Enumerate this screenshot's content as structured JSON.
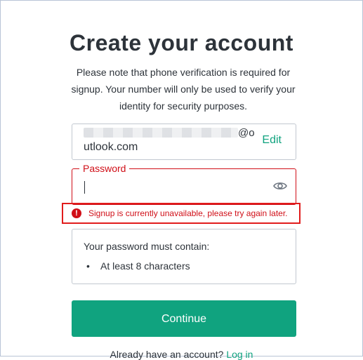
{
  "page": {
    "title": "Create your account",
    "subtitle": "Please note that phone verification is required for signup. Your number will only be used to verify your identity for security purposes."
  },
  "email": {
    "visible_suffix_line1": "@o",
    "visible_suffix_line2": "utlook.com",
    "edit_label": "Edit"
  },
  "password": {
    "label": "Password",
    "value": "",
    "error": "Signup is currently unavailable, please try again later.",
    "error_icon": "!"
  },
  "requirements": {
    "title": "Your password must contain:",
    "bullet": "•",
    "items": [
      "At least 8 characters"
    ]
  },
  "actions": {
    "continue_label": "Continue"
  },
  "footer": {
    "prompt": "Already have an account?",
    "login_label": "Log in"
  },
  "colors": {
    "accent": "#10a37f",
    "error": "#d00e17",
    "text": "#2d333a",
    "border": "#c2c8d0"
  }
}
